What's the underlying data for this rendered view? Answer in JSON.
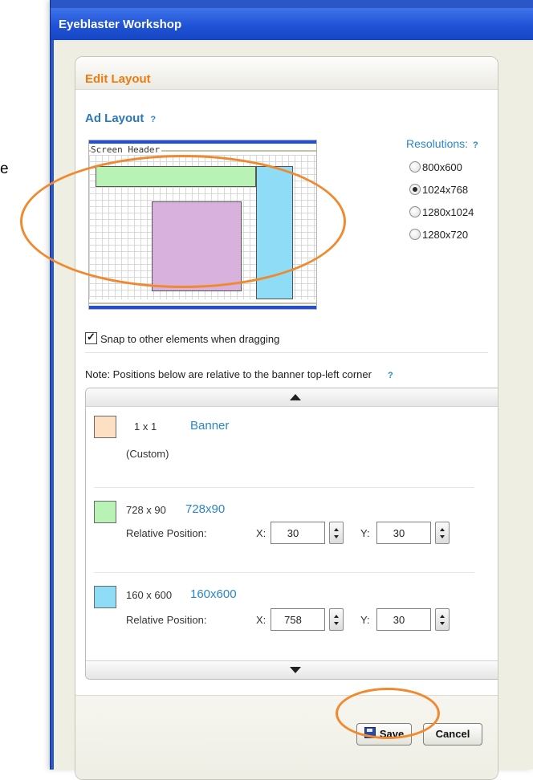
{
  "stray_text": "e",
  "window": {
    "title": "Eyeblaster Workshop"
  },
  "dialog": {
    "title": "Edit Layout",
    "section_title": "Ad Layout",
    "help_glyph": "?",
    "preview": {
      "screen_header_label": "Screen Header"
    },
    "resolutions": {
      "label": "Resolutions:",
      "options": [
        "800x600",
        "1024x768",
        "1280x1024",
        "1280x720"
      ],
      "selected": "1024x768"
    },
    "snap_label": "Snap to other elements when dragging",
    "snap_checked": true,
    "note": "Note: Positions below are relative to the banner top-left corner",
    "items": [
      {
        "size": "1 x 1",
        "name": "Banner",
        "sub": "(Custom)",
        "color": "#fde0c4"
      },
      {
        "size": "728 x 90",
        "name": "728x90",
        "position_label": "Relative Position:",
        "x_label": "X:",
        "x": "30",
        "y_label": "Y:",
        "y": "30",
        "color": "#b8f2b4"
      },
      {
        "size": "160 x 600",
        "name": "160x600",
        "position_label": "Relative Position:",
        "x_label": "X:",
        "x": "758",
        "y_label": "Y:",
        "y": "30",
        "color": "#8fdcf6"
      }
    ],
    "buttons": {
      "save": "Save",
      "cancel": "Cancel"
    }
  },
  "colors": {
    "accent_orange": "#f07a10",
    "link_blue": "#2b86c8",
    "title_bar": "#1f52d6",
    "highlight_circle": "#f08a30"
  }
}
